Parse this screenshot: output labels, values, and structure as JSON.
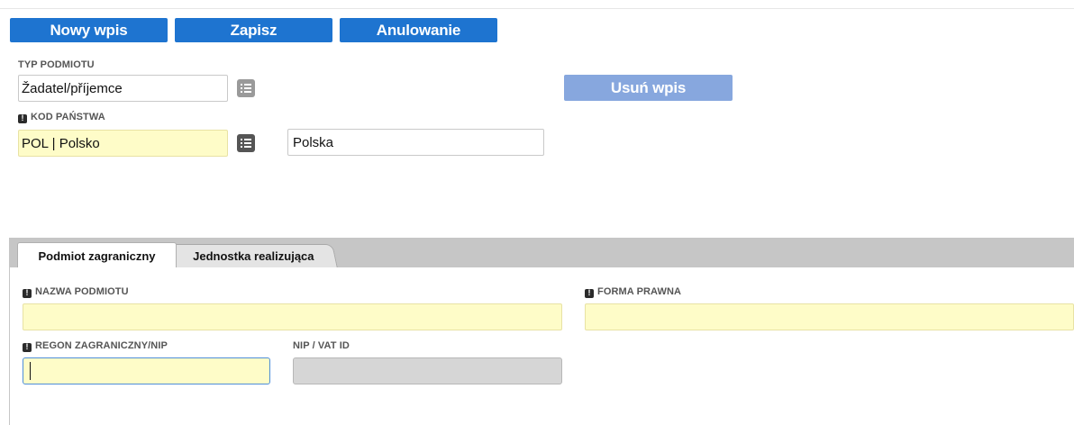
{
  "toolbar": {
    "new_entry": "Nowy wpis",
    "save": "Zapisz",
    "cancel": "Anulowanie"
  },
  "delete_button": "Usuń wpis",
  "entity_type": {
    "label": "TYP PODMIOTU",
    "value": "Žadatel/příjemce"
  },
  "country_code": {
    "label": "KOD PAŃSTWA",
    "value": "POL | Polsko",
    "name_value": "Polska"
  },
  "tabs": [
    {
      "label": "Podmiot zagraniczny",
      "active": true
    },
    {
      "label": "Jednostka realizująca",
      "active": false
    }
  ],
  "form": {
    "entity_name": {
      "label": "NAZWA PODMIOTU",
      "value": ""
    },
    "legal_form": {
      "label": "FORMA PRAWNA",
      "value": ""
    },
    "regon": {
      "label": "REGON ZAGRANICZNY/NIP",
      "value": ""
    },
    "nip_vat": {
      "label": "NIP / VAT ID",
      "value": ""
    }
  },
  "required_marker": "!",
  "colors": {
    "primary_button": "#1e74d0",
    "disabled_button": "#87a7de",
    "required_field": "#fefcc8",
    "readonly_field": "#d6d6d6"
  }
}
